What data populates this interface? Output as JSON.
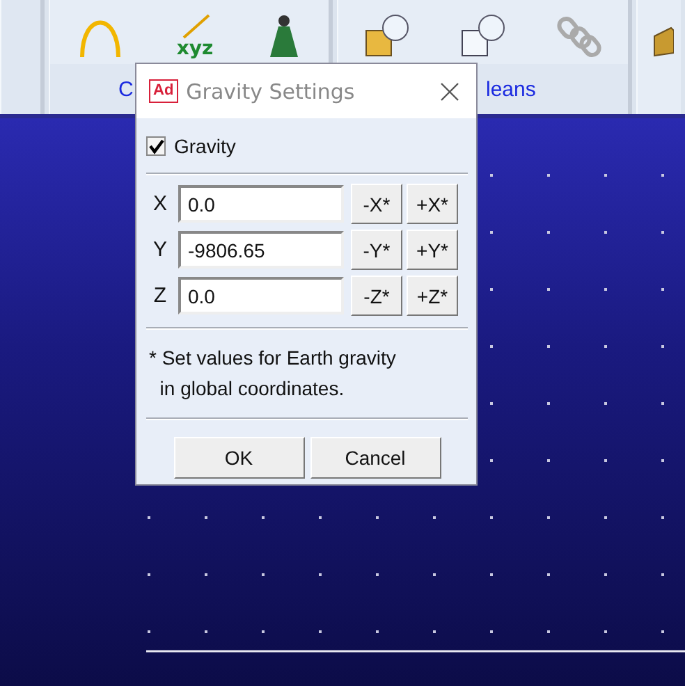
{
  "ribbon": {
    "axis_icon_text": "xyz",
    "group_labels": [
      "C",
      "leans"
    ]
  },
  "dialog": {
    "title": "Gravity Settings",
    "app_badge": "Ad",
    "gravity": {
      "label": "Gravity",
      "checked": true
    },
    "axes": [
      {
        "label": "X",
        "value": "0.0",
        "minus": "-X*",
        "plus": "+X*"
      },
      {
        "label": "Y",
        "value": "-9806.65",
        "minus": "-Y*",
        "plus": "+Y*"
      },
      {
        "label": "Z",
        "value": "0.0",
        "minus": "-Z*",
        "plus": "+Z*"
      }
    ],
    "note": "* Set values for Earth gravity\n  in global coordinates.",
    "buttons": [
      "OK",
      "Cancel"
    ]
  }
}
